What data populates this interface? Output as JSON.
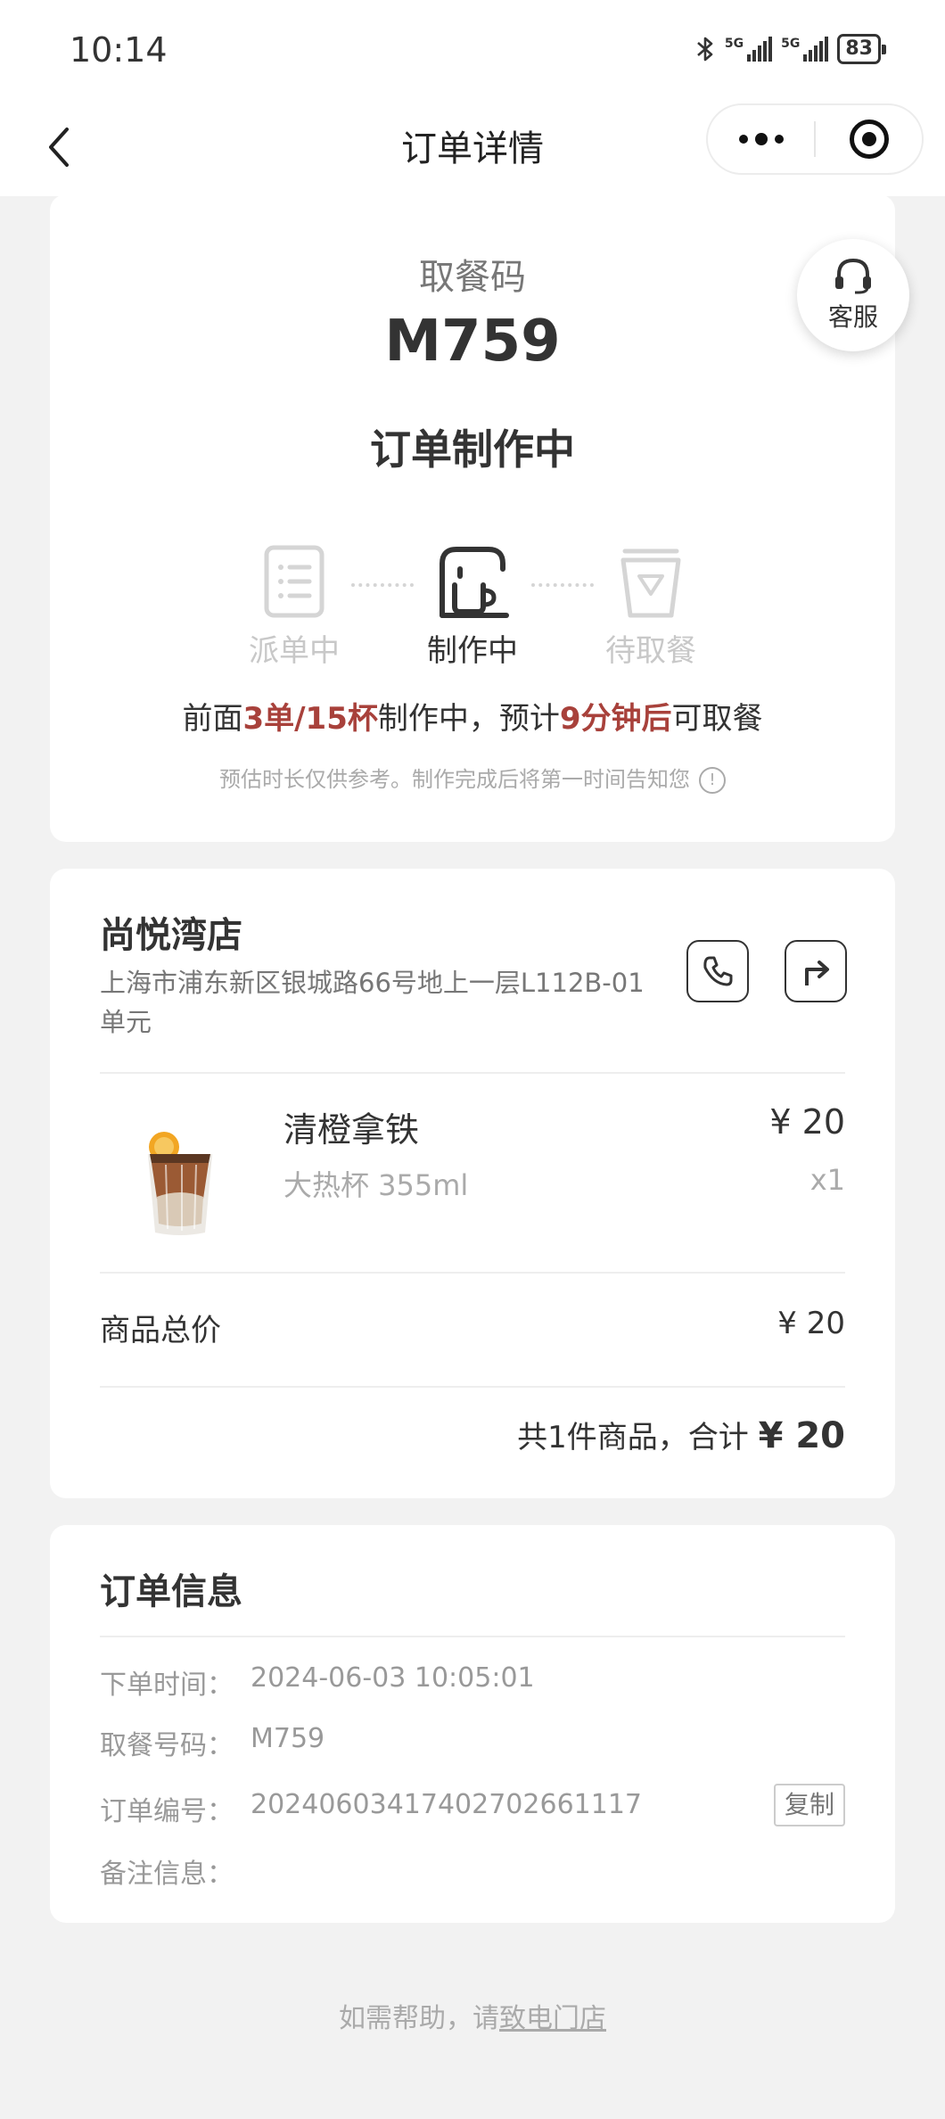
{
  "status_bar": {
    "time": "10:14",
    "net1": "5G",
    "net2": "5G",
    "battery": "83"
  },
  "nav": {
    "title": "订单详情"
  },
  "pickup": {
    "label": "取餐码",
    "code": "M759",
    "status": "订单制作中",
    "steps": [
      "派单中",
      "制作中",
      "待取餐"
    ],
    "active_step": 1,
    "queue_prefix": "前面",
    "queue_count": "3单/15杯",
    "queue_mid": "制作中，预计",
    "queue_time": "9分钟后",
    "queue_suffix": "可取餐",
    "note": "预估时长仅供参考。制作完成后将第一时间告知您",
    "info_glyph": "!",
    "service_label": "客服"
  },
  "store": {
    "name": "尚悦湾店",
    "address": "上海市浦东新区银城路66号地上一层L112B-01单元",
    "product": {
      "name": "清橙拿铁",
      "spec": "大热杯 355ml",
      "price": "¥ 20",
      "qty": "x1"
    },
    "subtotal_label": "商品总价",
    "subtotal_value": "¥ 20",
    "total_prefix": "共1件商品，合计",
    "total_amount": "¥ 20"
  },
  "order_info": {
    "title": "订单信息",
    "time_label": "下单时间：",
    "time_value": "2024-06-03 10:05:01",
    "code_label": "取餐号码：",
    "code_value": "M759",
    "number_label": "订单编号：",
    "number_value": "20240603417402702661117",
    "remark_label": "备注信息：",
    "copy_label": "复制"
  },
  "help": {
    "prefix": "如需帮助，请",
    "link": "致电门店"
  },
  "colors": {
    "highlight": "#a8413b",
    "text": "#333333",
    "muted": "#aaaaaa",
    "background": "#f2f2f2"
  },
  "icons": [
    "bluetooth-icon",
    "signal-icon",
    "battery-icon",
    "back-arrow-icon",
    "more-icon",
    "close-mini-program-icon",
    "headset-icon",
    "order-list-icon",
    "coffee-machine-icon",
    "pickup-cup-icon",
    "info-icon",
    "phone-icon",
    "navigation-icon"
  ]
}
